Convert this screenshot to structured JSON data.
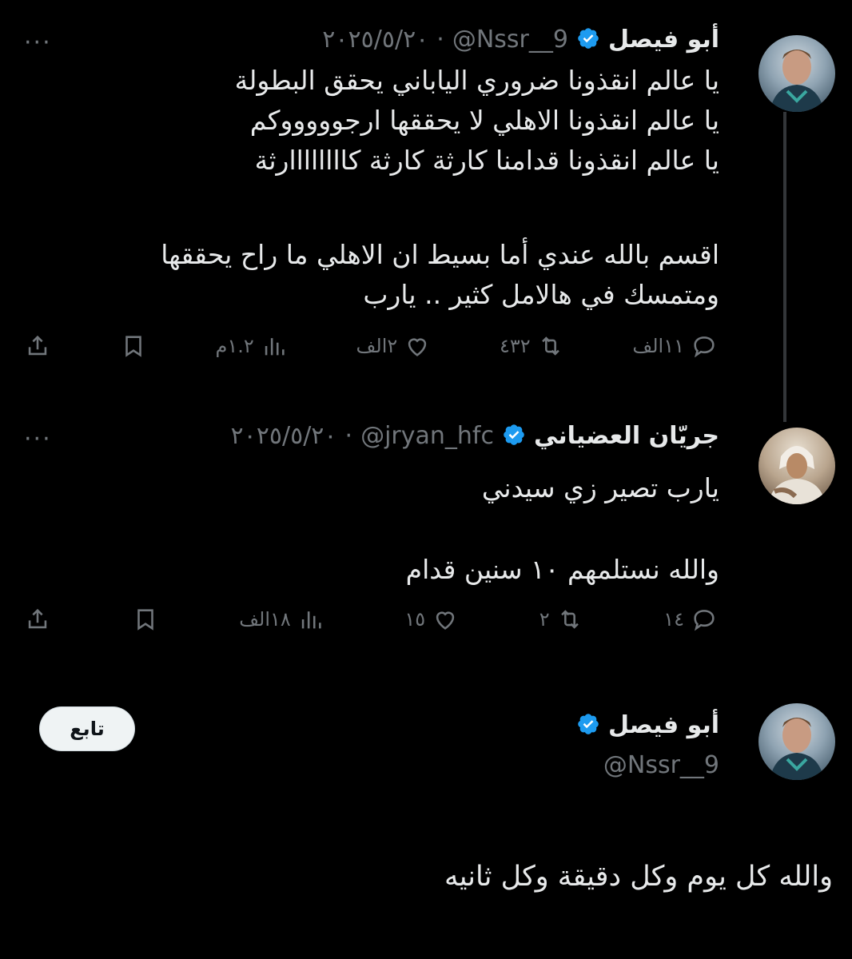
{
  "tweets": [
    {
      "name": "أبو فيصل",
      "handle": "@Nssr__9",
      "separator": "·",
      "date": "٢٠٢٥/٥/٢٠",
      "more": "···",
      "lines": [
        "يا عالم انقذونا ضروري الياباني يحقق البطولة",
        "يا عالم انقذونا الاهلي لا يحققها ارجوووووكم",
        "يا عالم انقذونا قدامنا كارثة كارثة كاااااااارثة"
      ],
      "lines2": [
        "اقسم بالله عندي أما بسيط ان الاهلي ما راح يحققها",
        "ومتمسك في هالامل كثير .. يارب"
      ],
      "stats": {
        "replies": "١١الف",
        "retweets": "٤٣٢",
        "likes": "٢الف",
        "views": "١.٢م"
      }
    },
    {
      "name": "جريّان العضياني",
      "handle": "@jryan_hfc",
      "separator": "·",
      "date": "٢٠٢٥/٥/٢٠",
      "more": "···",
      "lines": [
        "يارب تصير زي سيدني"
      ],
      "lines2": [
        "والله نستلمهم ١٠ سنين قدام"
      ],
      "stats": {
        "replies": "١٤",
        "retweets": "٢",
        "likes": "١٥",
        "views": "١٨الف"
      }
    }
  ],
  "profile": {
    "name": "أبو فيصل",
    "handle": "@Nssr__9",
    "follow_label": "تابع",
    "post": "والله كل يوم وكل دقيقة وكل ثانيه"
  },
  "colors": {
    "background": "#000000",
    "verified": "#1d9bf0",
    "muted": "#71767b",
    "text": "#e7e9ea"
  },
  "icons": [
    "reply-icon",
    "retweet-icon",
    "like-icon",
    "views-icon",
    "bookmark-icon",
    "share-icon",
    "verified-badge-icon"
  ]
}
